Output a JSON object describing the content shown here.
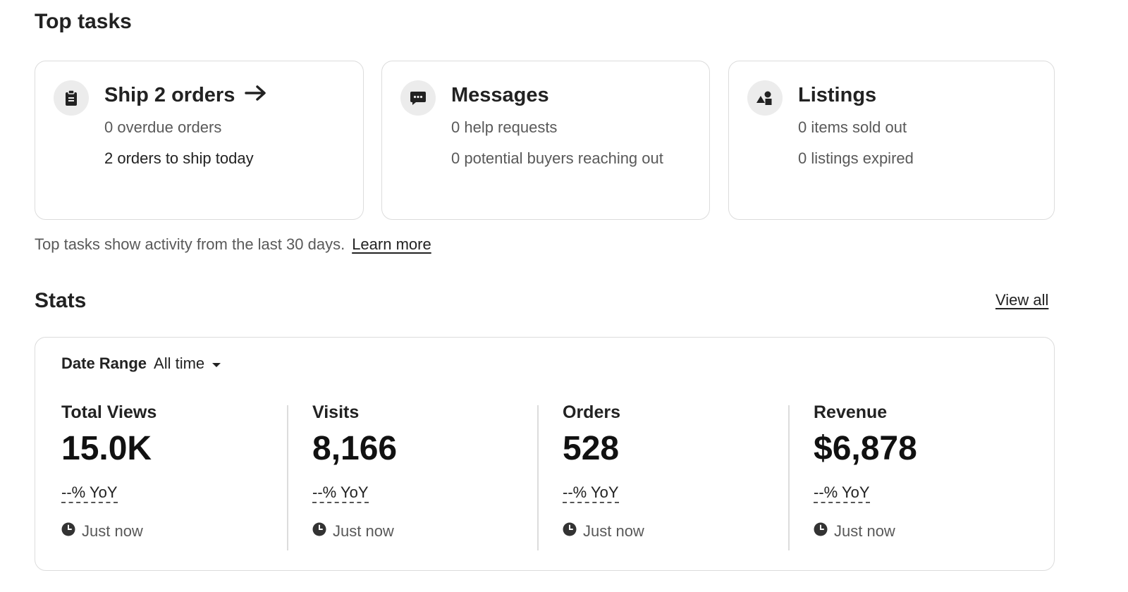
{
  "top_tasks": {
    "title": "Top tasks",
    "cards": [
      {
        "icon": "clipboard-icon",
        "title": "Ship 2 orders",
        "lines": [
          "0 overdue orders",
          "2 orders to ship today"
        ]
      },
      {
        "icon": "chat-bubble-icon",
        "title": "Messages",
        "lines": [
          "0 help requests",
          "0 potential buyers reaching out"
        ]
      },
      {
        "icon": "shapes-icon",
        "title": "Listings",
        "lines": [
          "0 items sold out",
          "0 listings expired"
        ]
      }
    ],
    "note": "Top tasks show activity from the last 30 days.",
    "learn_more": "Learn more"
  },
  "stats": {
    "title": "Stats",
    "view_all": "View all",
    "date_range": {
      "label": "Date Range",
      "value": "All time"
    },
    "items": [
      {
        "label": "Total Views",
        "value": "15.0K",
        "yoy": "--% YoY",
        "updated": "Just now"
      },
      {
        "label": "Visits",
        "value": "8,166",
        "yoy": "--% YoY",
        "updated": "Just now"
      },
      {
        "label": "Orders",
        "value": "528",
        "yoy": "--% YoY",
        "updated": "Just now"
      },
      {
        "label": "Revenue",
        "value": "$6,878",
        "yoy": "--% YoY",
        "updated": "Just now"
      }
    ]
  },
  "colors": {
    "text": "#222222",
    "muted": "#595959",
    "border": "#dcdcdc",
    "icon_bg": "#ececec"
  }
}
